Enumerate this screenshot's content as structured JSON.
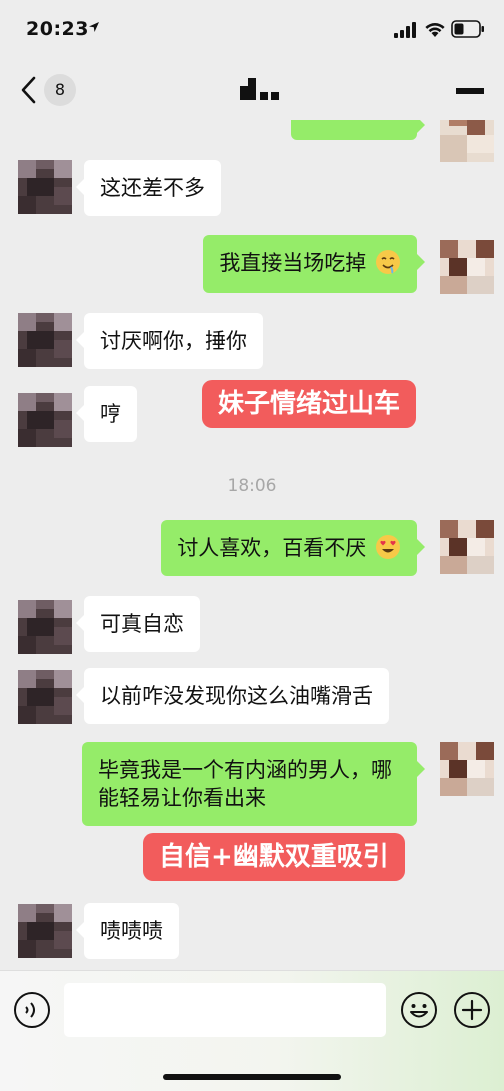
{
  "status": {
    "time": "20:23"
  },
  "nav": {
    "unread_count": "8"
  },
  "messages": [
    {
      "side": "out",
      "text": "",
      "partial": true
    },
    {
      "side": "in",
      "text": "这还差不多"
    },
    {
      "side": "out",
      "text": "我直接当场吃掉",
      "emoji": "drooling-face-emoji"
    },
    {
      "side": "in",
      "text": "讨厌啊你，捶你"
    },
    {
      "side": "in",
      "text": "哼"
    },
    {
      "side": "out",
      "text": "讨人喜欢，百看不厌",
      "emoji": "heart-eyes-emoji"
    },
    {
      "side": "in",
      "text": "可真自恋"
    },
    {
      "side": "in",
      "text": "以前咋没发现你这么油嘴滑舌"
    },
    {
      "side": "out",
      "text": "毕竟我是一个有内涵的男人，哪能轻易让你看出来"
    },
    {
      "side": "in",
      "text": "啧啧啧"
    }
  ],
  "timestamp": "18:06",
  "annotations": [
    {
      "text": "妹子情绪过山车"
    },
    {
      "text": "自信+幽默双重吸引"
    }
  ],
  "input": {
    "value": ""
  },
  "colors": {
    "background": "#ededed",
    "outgoing_bubble": "#95ec69",
    "incoming_bubble": "#ffffff",
    "annotation": "#f25c5c"
  }
}
